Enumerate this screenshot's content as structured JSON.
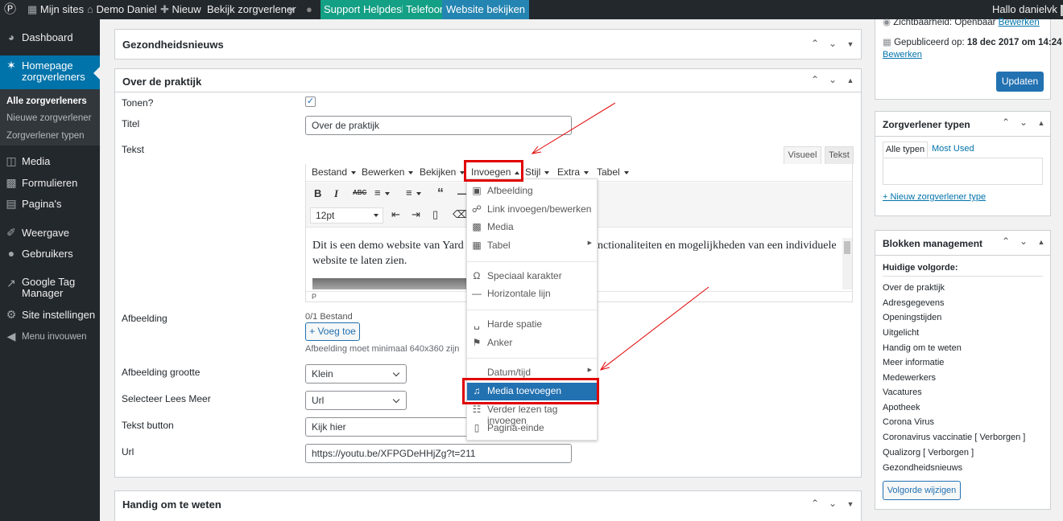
{
  "adminbar": {
    "my_sites": "Mijn sites",
    "site_name": "Demo Daniel",
    "new": "Nieuw",
    "view": "Bekijk zorgverlener",
    "support": "Support",
    "helpdesk": "Helpdesk",
    "telefoon": "Telefoon",
    "website": "Website bekijken",
    "greeting": "Hallo danielvk"
  },
  "sidebar": {
    "dashboard": "Dashboard",
    "homepage_line1": "Homepage",
    "homepage_line2": "zorgverleners",
    "sub_all": "Alle zorgverleners",
    "sub_new": "Nieuwe zorgverlener",
    "sub_types": "Zorgverlener typen",
    "media": "Media",
    "formulieren": "Formulieren",
    "paginas": "Pagina's",
    "weergave": "Weergave",
    "gebruikers": "Gebruikers",
    "gtm_line1": "Google Tag",
    "gtm_line2": "Manager",
    "site_settings": "Site instellingen",
    "collapse": "Menu invouwen"
  },
  "boxes": {
    "gezondheidsnieuws": "Gezondheidsnieuws",
    "over": "Over de praktijk",
    "handig": "Handig om te weten"
  },
  "form": {
    "tonen_label": "Tonen?",
    "titel_label": "Titel",
    "titel_value": "Over de praktijk",
    "tekst_label": "Tekst",
    "afbeelding_label": "Afbeelding",
    "afbeelding_count": "0/1 Bestand",
    "afbeelding_add": "+ Voeg toe",
    "afbeelding_hint": "Afbeelding moet minimaal 640x360 zijn",
    "grootte_label": "Afbeelding grootte",
    "grootte_value": "Klein",
    "leesmeer_label": "Selecteer Lees Meer",
    "leesmeer_value": "Url",
    "button_label": "Tekst button",
    "button_value": "Kijk hier",
    "url_label": "Url",
    "url_value": "https://youtu.be/XFPGDeHHjZg?t=211"
  },
  "editor": {
    "tab_visual": "Visueel",
    "tab_text": "Tekst",
    "menus": [
      "Bestand",
      "Bewerken",
      "Bekijken",
      "Invoegen",
      "Stijl",
      "Extra",
      "Tabel"
    ],
    "fontsize": "12pt",
    "content_left": "Dit is een demo website van Yard z",
    "content_right": "nctionaliteiten en mogelijkheden van een individuele",
    "content_line2": "website te laten zien.",
    "statusbar": "P"
  },
  "dropdown": {
    "afbeelding": "Afbeelding",
    "link": "Link invoegen/bewerken",
    "media": "Media",
    "tabel": "Tabel",
    "speciaal": "Speciaal karakter",
    "lijn": "Horizontale lijn",
    "spatie": "Harde spatie",
    "anker": "Anker",
    "datum": "Datum/tijd",
    "media_toevoegen": "Media toevoegen",
    "verder": "Verder lezen tag invoegen",
    "pagina": "Pagina-einde"
  },
  "publish": {
    "visibility": "Zichtbaarheid: Openbaar",
    "visibility_edit": "Bewerken",
    "published": "Gepubliceerd op:",
    "published_date": "18 dec 2017 om 14:24",
    "published_edit": "Bewerken",
    "update": "Updaten"
  },
  "types": {
    "title": "Zorgverlener typen",
    "tab_all": "Alle typen",
    "tab_most": "Most Used",
    "add": "+ Nieuw zorgverlener type"
  },
  "blocks": {
    "title": "Blokken management",
    "subtitle": "Huidige volgorde:",
    "items": [
      "Over de praktijk",
      "Adresgegevens",
      "Openingstijden",
      "Uitgelicht",
      "Handig om te weten",
      "Meer informatie",
      "Medewerkers",
      "Vacatures",
      "Apotheek",
      "Corona Virus",
      "Coronavirus vaccinatie [ Verborgen ]",
      "Qualizorg [ Verborgen ]",
      "Gezondheidsnieuws"
    ],
    "button": "Volgorde wijzigen"
  },
  "colors": {
    "adminbar": "#23282d",
    "accent": "#0073aa",
    "highlight": "#e00000"
  }
}
